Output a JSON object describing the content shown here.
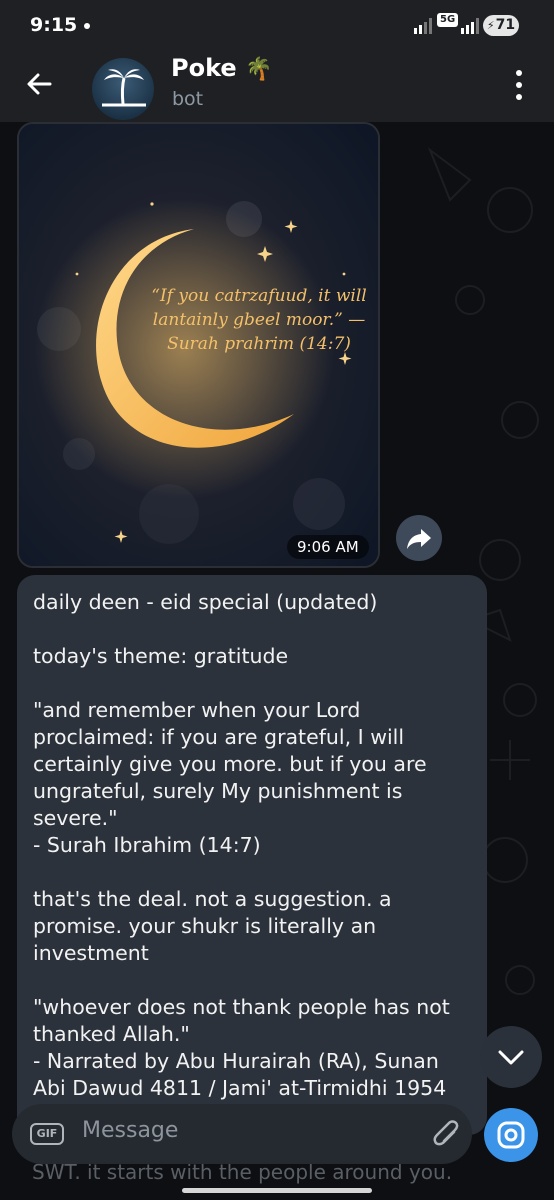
{
  "status_bar": {
    "time": "9:15",
    "network": "5G",
    "battery": "71"
  },
  "header": {
    "title": "Poke",
    "title_emoji": "🌴",
    "subtitle": "bot"
  },
  "image_message": {
    "quote": "“If you catrzafuud, it will lantainly gbeel moor.” — Surah prahrim (14:7)",
    "time": "9:06 AM"
  },
  "text_message": {
    "paragraphs": [
      "daily deen - eid special (updated)",
      "today's theme: gratitude",
      "\"and remember when your Lord proclaimed: if you are grateful, I will certainly give you more. but if you are ungrateful, surely My punishment is severe.\"\n- Surah Ibrahim (14:7)",
      "that's the deal. not a suggestion. a promise. your shukr is literally an investment",
      "\"whoever does not thank people has not thanked Allah.\"\n- Narrated by Abu Hurairah (RA), Sunan Abi Dawud 4811 / Jami' at-Tirmidhi 1954"
    ],
    "partial_below": "SWT. it starts with the people around you."
  },
  "input": {
    "gif_label": "GIF",
    "placeholder": "Message"
  },
  "colors": {
    "accent": "#3b94e8",
    "bubble": "#2c323b",
    "header": "#1e2024"
  },
  "icons": [
    "back-arrow-icon",
    "more-vert-icon",
    "forward-icon",
    "chevron-down-icon",
    "gif-icon",
    "paperclip-icon",
    "camera-icon"
  ]
}
